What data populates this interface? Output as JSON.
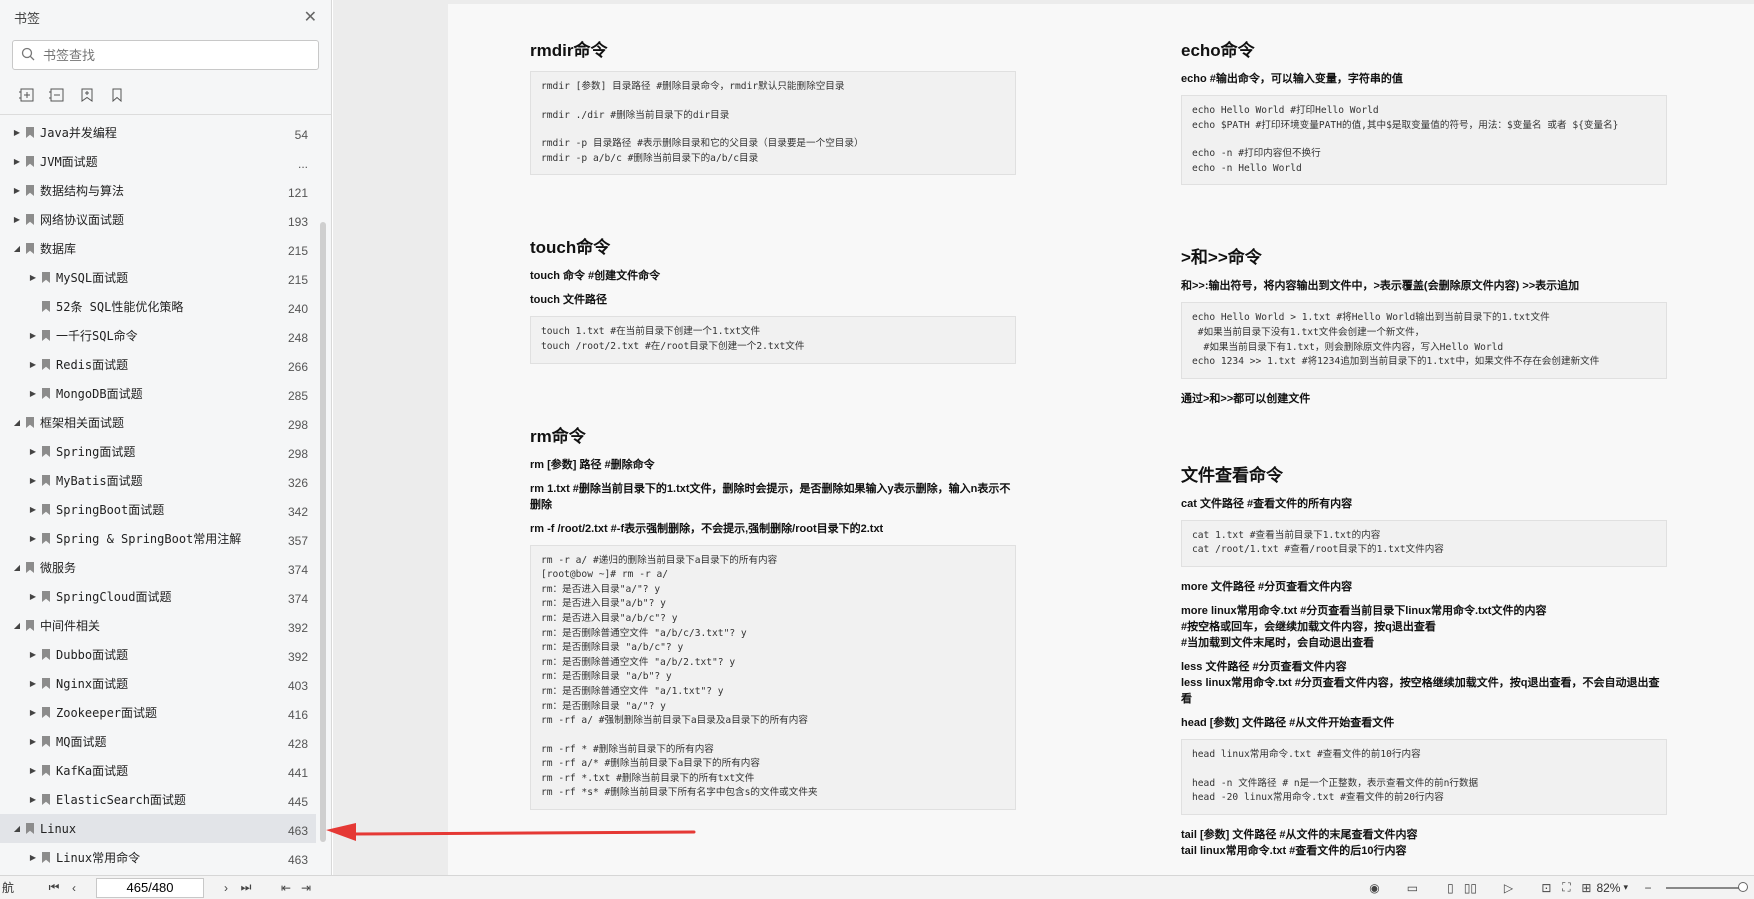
{
  "sidebar": {
    "title": "书签",
    "close_icon": "close-icon",
    "search_placeholder": "书签查找",
    "tools": [
      "expand-all-icon",
      "collapse-all-icon",
      "add-bookmark-icon",
      "bookmark-icon"
    ],
    "items": [
      {
        "label": "Java并发编程",
        "num": "54",
        "level": 0,
        "expanded": false
      },
      {
        "label": "JVM面试题",
        "num": "...",
        "level": 0,
        "expanded": false
      },
      {
        "label": "数据结构与算法",
        "num": "121",
        "level": 0,
        "expanded": false
      },
      {
        "label": "网络协议面试题",
        "num": "193",
        "level": 0,
        "expanded": false
      },
      {
        "label": "数据库",
        "num": "215",
        "level": 0,
        "expanded": true
      },
      {
        "label": "MySQL面试题",
        "num": "215",
        "level": 1,
        "expanded": false
      },
      {
        "label": "52条 SQL性能优化策略",
        "num": "240",
        "level": 1,
        "expanded": null
      },
      {
        "label": "一千行SQL命令",
        "num": "248",
        "level": 1,
        "expanded": false
      },
      {
        "label": "Redis面试题",
        "num": "266",
        "level": 1,
        "expanded": false
      },
      {
        "label": "MongoDB面试题",
        "num": "285",
        "level": 1,
        "expanded": false
      },
      {
        "label": "框架相关面试题",
        "num": "298",
        "level": 0,
        "expanded": true
      },
      {
        "label": "Spring面试题",
        "num": "298",
        "level": 1,
        "expanded": false
      },
      {
        "label": "MyBatis面试题",
        "num": "326",
        "level": 1,
        "expanded": false
      },
      {
        "label": "SpringBoot面试题",
        "num": "342",
        "level": 1,
        "expanded": false
      },
      {
        "label": "Spring & SpringBoot常用注解",
        "num": "357",
        "level": 1,
        "expanded": false
      },
      {
        "label": "微服务",
        "num": "374",
        "level": 0,
        "expanded": true
      },
      {
        "label": "SpringCloud面试题",
        "num": "374",
        "level": 1,
        "expanded": false
      },
      {
        "label": "中间件相关",
        "num": "392",
        "level": 0,
        "expanded": true
      },
      {
        "label": "Dubbo面试题",
        "num": "392",
        "level": 1,
        "expanded": false
      },
      {
        "label": "Nginx面试题",
        "num": "403",
        "level": 1,
        "expanded": false
      },
      {
        "label": "Zookeeper面试题",
        "num": "416",
        "level": 1,
        "expanded": false
      },
      {
        "label": "MQ面试题",
        "num": "428",
        "level": 1,
        "expanded": false
      },
      {
        "label": "KafKa面试题",
        "num": "441",
        "level": 1,
        "expanded": false
      },
      {
        "label": "ElasticSearch面试题",
        "num": "445",
        "level": 1,
        "expanded": false
      },
      {
        "label": "Linux",
        "num": "463",
        "level": 0,
        "expanded": true,
        "selected": true
      },
      {
        "label": "Linux常用命令",
        "num": "463",
        "level": 1,
        "expanded": false
      }
    ]
  },
  "doc": {
    "left": [
      {
        "t": "h",
        "text": "rmdir命令"
      },
      {
        "t": "code",
        "lines": [
          "rmdir [参数] 目录路径 #删除目录命令，rmdir默认只能删除空目录",
          "",
          "rmdir ./dir #删除当前目录下的dir目录",
          "",
          "rmdir -p 目录路径 #表示删除目录和它的父目录（目录要是一个空目录）",
          "rmdir -p a/b/c #删除当前目录下的a/b/c目录"
        ]
      },
      {
        "t": "gap"
      },
      {
        "t": "h",
        "text": "touch命令"
      },
      {
        "t": "p",
        "text": "touch 命令 #创建文件命令"
      },
      {
        "t": "p",
        "text": "touch 文件路径"
      },
      {
        "t": "code",
        "lines": [
          "touch 1.txt #在当前目录下创建一个1.txt文件",
          "touch /root/2.txt #在/root目录下创建一个2.txt文件"
        ]
      },
      {
        "t": "gap"
      },
      {
        "t": "h",
        "text": "rm命令"
      },
      {
        "t": "p",
        "text": "rm [参数] 路径 #删除命令"
      },
      {
        "t": "p",
        "text": "rm 1.txt #删除当前目录下的1.txt文件，删除时会提示，是否删除如果输入y表示删除，输入n表示不删除"
      },
      {
        "t": "p",
        "text": "rm -f /root/2.txt #-f表示强制删除，不会提示,强制删除/root目录下的2.txt"
      },
      {
        "t": "code",
        "lines": [
          "rm -r a/ #递归的删除当前目录下a目录下的所有内容",
          "[root@bow ~]# rm -r a/",
          "rm：是否进入目录\"a/\"? y",
          "rm：是否进入目录\"a/b\"? y",
          "rm：是否进入目录\"a/b/c\"? y",
          "rm：是否删除普通空文件 \"a/b/c/3.txt\"? y",
          "rm：是否删除目录 \"a/b/c\"? y",
          "rm：是否删除普通空文件 \"a/b/2.txt\"? y",
          "rm：是否删除目录 \"a/b\"? y",
          "rm：是否删除普通空文件 \"a/1.txt\"? y",
          "rm：是否删除目录 \"a/\"? y",
          "rm -rf a/ #强制删除当前目录下a目录及a目录下的所有内容",
          "",
          "rm -rf * #删除当前目录下的所有内容",
          "rm -rf a/* #删除当前目录下a目录下的所有内容",
          "rm -rf *.txt #删除当前目录下的所有txt文件",
          "rm -rf *s* #删除当前目录下所有名字中包含s的文件或文件夹"
        ]
      }
    ],
    "right": [
      {
        "t": "h",
        "text": "echo命令"
      },
      {
        "t": "p",
        "text": "echo #输出命令，可以输入变量，字符串的值"
      },
      {
        "t": "code",
        "lines": [
          "echo Hello World #打印Hello World",
          "echo $PATH #打印环境变量PATH的值,其中$是取变量值的符号，用法：$变量名 或者 ${变量名}",
          "",
          "echo -n #打印内容但不换行",
          "echo -n Hello World"
        ]
      },
      {
        "t": "gap"
      },
      {
        "t": "h",
        "text": ">和>>命令"
      },
      {
        "t": "p",
        "text": "和>>:输出符号，将内容输出到文件中，>表示覆盖(会删除原文件内容) >>表示追加"
      },
      {
        "t": "code",
        "lines": [
          "echo Hello World > 1.txt #将Hello World输出到当前目录下的1.txt文件",
          " #如果当前目录下没有1.txt文件会创建一个新文件，",
          "  #如果当前目录下有1.txt，则会删除原文件内容，写入Hello World",
          "echo 1234 >> 1.txt #将1234追加到当前目录下的1.txt中，如果文件不存在会创建新文件"
        ]
      },
      {
        "t": "p",
        "text": "通过>和>>都可以创建文件"
      },
      {
        "t": "gap"
      },
      {
        "t": "h",
        "text": "文件查看命令"
      },
      {
        "t": "p",
        "text": "cat 文件路径 #查看文件的所有内容"
      },
      {
        "t": "code",
        "lines": [
          "cat 1.txt #查看当前目录下1.txt的内容",
          "cat /root/1.txt #查看/root目录下的1.txt文件内容"
        ]
      },
      {
        "t": "p",
        "text": "more 文件路径 #分页查看文件内容"
      },
      {
        "t": "p",
        "text": "more linux常用命令.txt #分页查看当前目录下linux常用命令.txt文件的内容\n#按空格或回车，会继续加载文件内容，按q退出查看\n#当加载到文件末尾时，会自动退出查看"
      },
      {
        "t": "p",
        "text": "less 文件路径 #分页查看文件内容\nless linux常用命令.txt #分页查看文件内容，按空格继续加载文件，按q退出查看，不会自动退出查看"
      },
      {
        "t": "p",
        "text": "head [参数] 文件路径 #从文件开始查看文件"
      },
      {
        "t": "code",
        "lines": [
          "head linux常用命令.txt #查看文件的前10行内容",
          "",
          "head -n 文件路径 # n是一个正整数，表示查看文件的前n行数据",
          "head -20 linux常用命令.txt #查看文件的前20行内容"
        ]
      },
      {
        "t": "p",
        "text": "tail [参数] 文件路径 #从文件的末尾查看文件内容\ntail linux常用命令.txt #查看文件的后10行内容"
      }
    ]
  },
  "bottombar": {
    "left_text": "航",
    "page_value": "465/480",
    "zoom": "82%"
  }
}
